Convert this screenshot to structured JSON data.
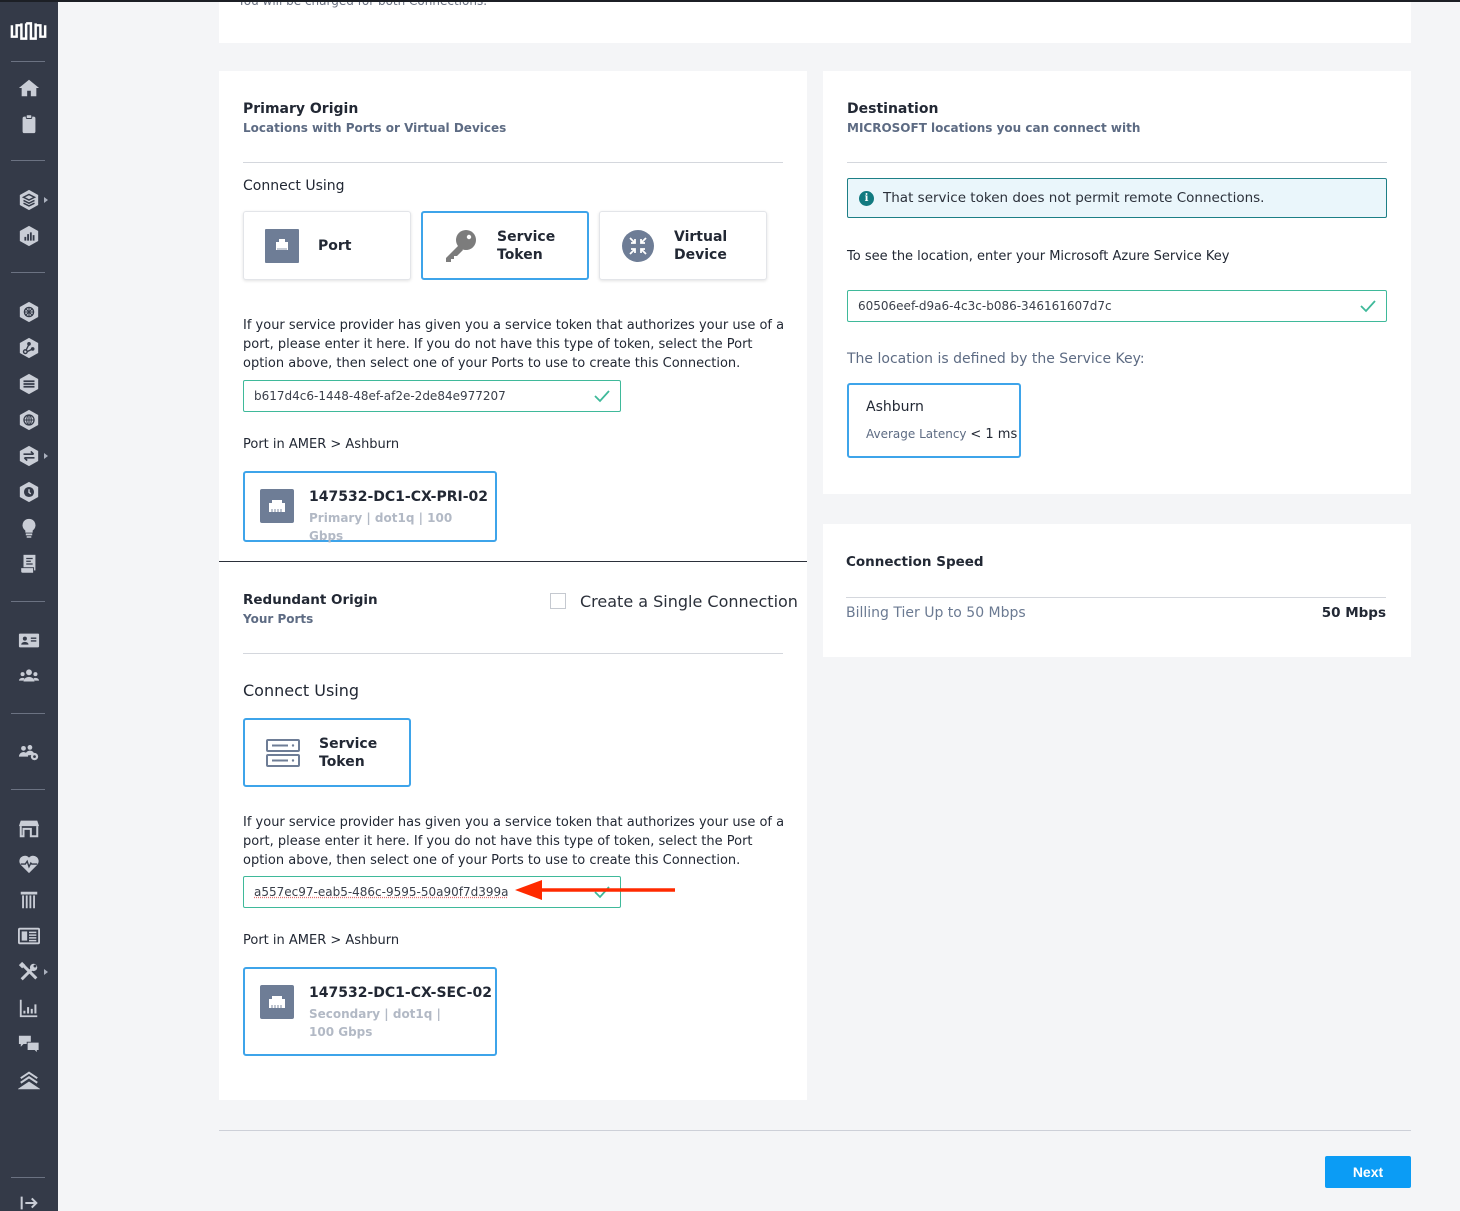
{
  "sidebar": {
    "logo": "equinix-logo-icon",
    "items": [
      {
        "icon": "home-icon"
      },
      {
        "icon": "clipboard-icon"
      },
      {
        "icon": "layers-hex-icon",
        "has_submenu": true
      },
      {
        "icon": "chart-hex-icon"
      },
      {
        "icon": "network-hex-icon"
      },
      {
        "icon": "nodes-hex-icon"
      },
      {
        "icon": "stack-hex-icon"
      },
      {
        "icon": "globe-hex-icon"
      },
      {
        "icon": "exchange-hex-icon",
        "has_submenu": true
      },
      {
        "icon": "clock-hex-icon"
      },
      {
        "icon": "lightbulb-icon"
      },
      {
        "icon": "scroll-icon"
      },
      {
        "icon": "id-card-icon"
      },
      {
        "icon": "users-icon"
      },
      {
        "icon": "users-gear-icon"
      },
      {
        "icon": "store-icon"
      },
      {
        "icon": "heartbeat-icon"
      },
      {
        "icon": "pillar-icon"
      },
      {
        "icon": "newspaper-icon"
      },
      {
        "icon": "tools-icon",
        "has_submenu": true
      },
      {
        "icon": "bar-chart-icon"
      },
      {
        "icon": "chat-icon"
      },
      {
        "icon": "chevrons-up-icon"
      }
    ],
    "collapse_icon": "expand-arrow-icon"
  },
  "top_note": "You will be charged for both Connections.",
  "primary": {
    "title": "Primary Origin",
    "subtitle": "Locations with Ports or Virtual Devices",
    "connect_using_label": "Connect Using",
    "options": [
      {
        "label_line1": "Port",
        "label_line2": "",
        "icon": "port-icon",
        "selected": false
      },
      {
        "label_line1": "Service",
        "label_line2": "Token",
        "icon": "key-icon",
        "selected": true
      },
      {
        "label_line1": "Virtual",
        "label_line2": "Device",
        "icon": "virtual-device-icon",
        "selected": false
      }
    ],
    "help_text": "If your service provider has given you a service token that authorizes your use of a port, please enter it here. If you do not have this type of token, select the Port option above, then select one of your Ports to use to create this Connection.",
    "token_value": "b617d4c6-1448-48ef-af2e-2de84e977207",
    "port_location_label": "Port in AMER > Ashburn",
    "port": {
      "name": "147532-DC1-CX-PRI-02",
      "meta": "Primary | dot1q | 100 Gbps"
    }
  },
  "redundant": {
    "title": "Redundant Origin",
    "subtitle": "Your Ports",
    "single_connection_label": "Create a Single Connection",
    "single_connection_checked": false,
    "connect_using_label": "Connect Using",
    "option": {
      "label_line1": "Service",
      "label_line2": "Token",
      "icon": "server-token-icon",
      "selected": true
    },
    "help_text": "If your service provider has given you a service token that authorizes your use of a port, please enter it here. If you do not have this type of token, select the Port option above, then select one of your Ports to use to create this Connection.",
    "token_value": "a557ec97-eab5-486c-9595-50a90f7d399a",
    "port_location_label": "Port in AMER > Ashburn",
    "port": {
      "name": "147532-DC1-CX-SEC-02",
      "meta": "Secondary | dot1q | 100 Gbps"
    }
  },
  "destination": {
    "title": "Destination",
    "subtitle": "MICROSOFT locations you can connect with",
    "alert": "That service token does not permit remote Connections.",
    "service_key_label": "To see the location, enter your Microsoft Azure Service Key",
    "service_key_value": "60506eef-d9a6-4c3c-b086-346161607d7c",
    "location_defined_label": "The location is defined by the Service Key:",
    "location": {
      "name": "Ashburn",
      "latency_label": "Average Latency",
      "latency_value": "< 1 ms"
    }
  },
  "speed": {
    "title": "Connection Speed",
    "tier_label": "Billing Tier Up to 50 Mbps",
    "tier_value": "50 Mbps"
  },
  "footer": {
    "next_label": "Next"
  },
  "colors": {
    "accent": "#0b9cf5",
    "selected_border": "#3ea4ea",
    "valid": "#3fb99a",
    "annotation_arrow": "#ff2a00"
  }
}
